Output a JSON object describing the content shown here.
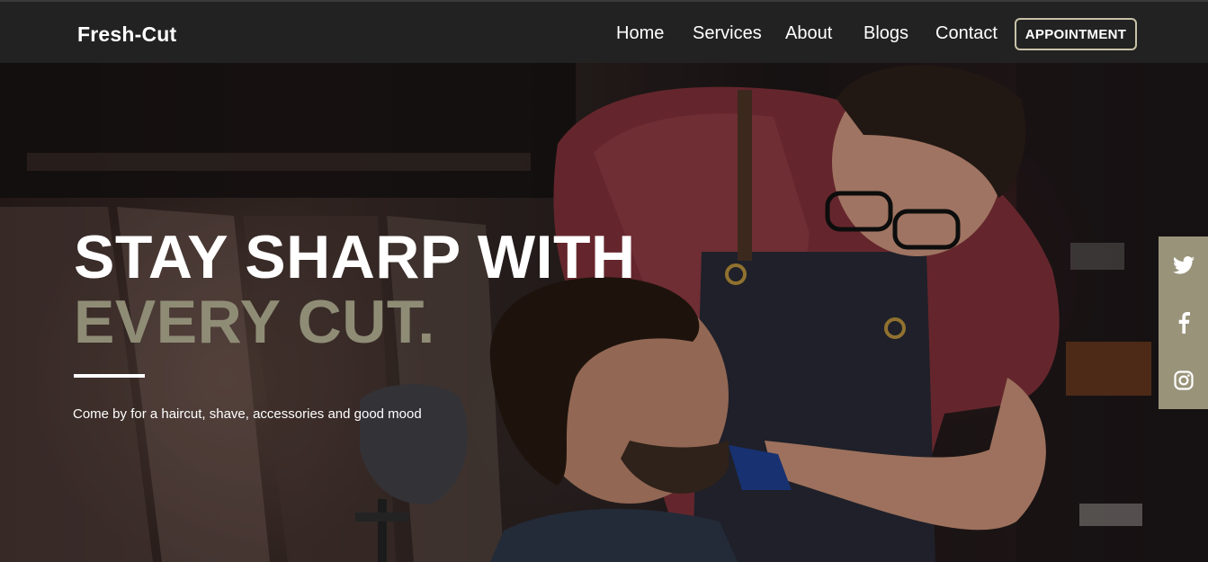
{
  "brand": {
    "name": "Fresh-Cut"
  },
  "nav": {
    "items": [
      {
        "label": "Home"
      },
      {
        "label": "Services"
      },
      {
        "label": "About"
      },
      {
        "label": "Blogs"
      },
      {
        "label": "Contact"
      }
    ],
    "cta_label": "APPOINTMENT"
  },
  "hero": {
    "headline_line1": "STAY SHARP WITH",
    "headline_line2": "EVERY CUT.",
    "tagline": "Come by for a haircut, shave, accessories and good mood",
    "background_image": "barber trimming customer's beard"
  },
  "social": {
    "icons": [
      "twitter-icon",
      "facebook-icon",
      "instagram-icon"
    ]
  },
  "colors": {
    "navbar_bg": "#222222",
    "accent": "#8f8c76",
    "social_bar_bg": "#99937a",
    "cta_border": "#c9c2a8",
    "text": "#ffffff"
  }
}
